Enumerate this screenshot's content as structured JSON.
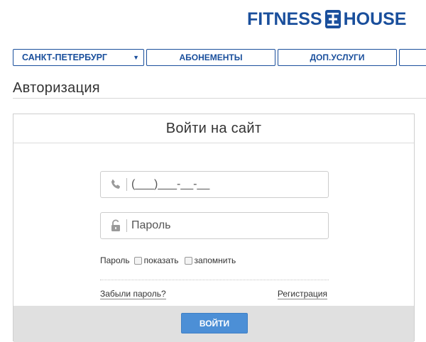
{
  "brand": {
    "word1": "FITNESS",
    "word2": "HOUSE",
    "color": "#1a4f9c"
  },
  "nav": {
    "city": "САНКТ-ПЕТЕРБУРГ",
    "subscriptions": "АБОНЕМЕНТЫ",
    "extra_services": "ДОП.УСЛУГИ"
  },
  "page": {
    "title": "Авторизация"
  },
  "login_form": {
    "heading": "Войти на сайт",
    "phone_value": "(___)___-__-__",
    "password_placeholder": "Пароль",
    "password_label": "Пароль",
    "show_label": "показать",
    "remember_label": "запомнить",
    "forgot_link": "Забыли пароль?",
    "register_link": "Регистрация",
    "submit_label": "ВОЙТИ",
    "accent_color": "#4c8fd6"
  },
  "icons": {
    "phone": "phone-icon",
    "lock": "lock-icon",
    "dropdown": "chevron-down-icon"
  }
}
